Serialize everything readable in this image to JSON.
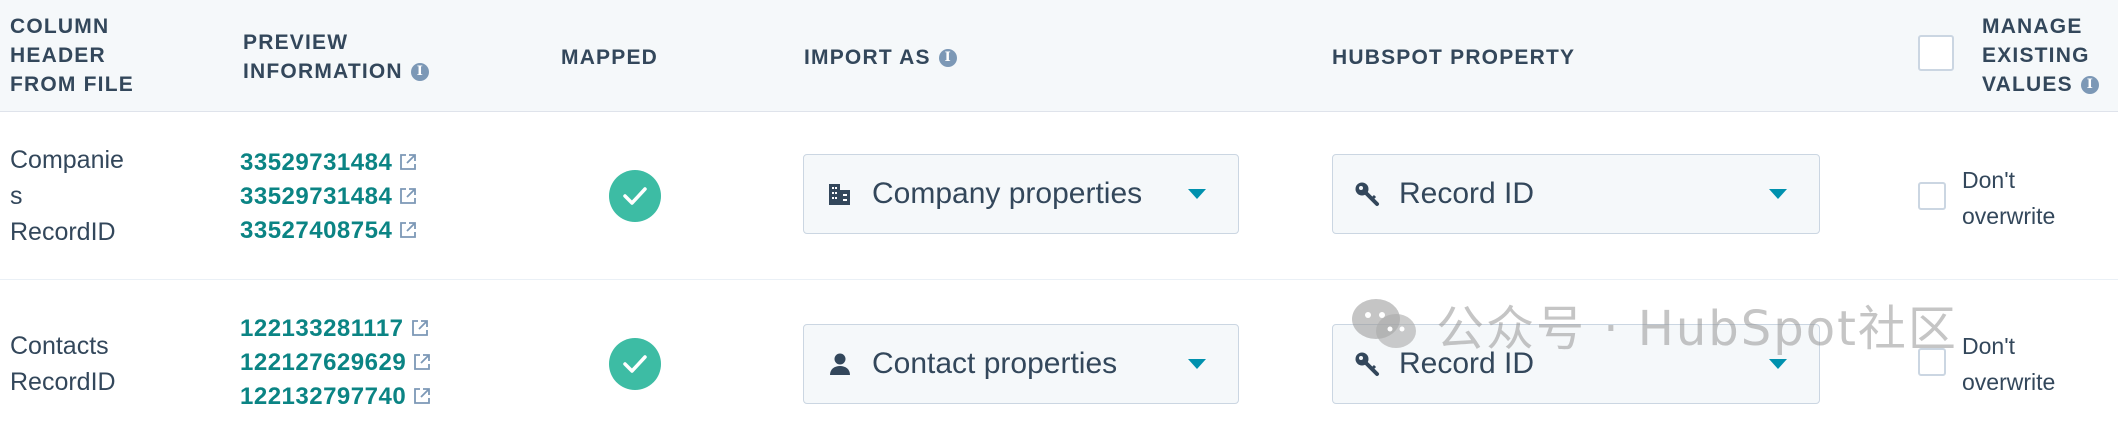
{
  "header": {
    "column_header": [
      "COLUMN",
      "HEADER",
      "FROM FILE"
    ],
    "preview": [
      "PREVIEW",
      "INFORMATION"
    ],
    "mapped": "MAPPED",
    "import_as": "IMPORT AS",
    "hubspot_property": "HUBSPOT PROPERTY",
    "manage": [
      "MANAGE",
      "EXISTING",
      "VALUES"
    ]
  },
  "rows": [
    {
      "column_name": [
        "Companie",
        "s",
        "RecordID"
      ],
      "preview_ids": [
        "33529731484",
        "33529731484",
        "33527408754"
      ],
      "mapped": true,
      "import_as": "Company properties",
      "import_icon": "building-icon",
      "property": "Record ID",
      "property_icon": "key-icon",
      "overwrite_label": [
        "Don't",
        "overwrite"
      ]
    },
    {
      "column_name": [
        "Contacts",
        "RecordID"
      ],
      "preview_ids": [
        "122133281117",
        "122127629629",
        "122132797740"
      ],
      "mapped": true,
      "import_as": "Contact properties",
      "import_icon": "person-icon",
      "property": "Record ID",
      "property_icon": "key-icon",
      "overwrite_label": [
        "Don't",
        "overwrite"
      ]
    }
  ],
  "watermark": "公众号 · HubSpot社区",
  "colors": {
    "accent": "#0b8484",
    "check": "#3dbca4",
    "caret": "#0091ae",
    "header_bg": "#f5f8fa"
  }
}
